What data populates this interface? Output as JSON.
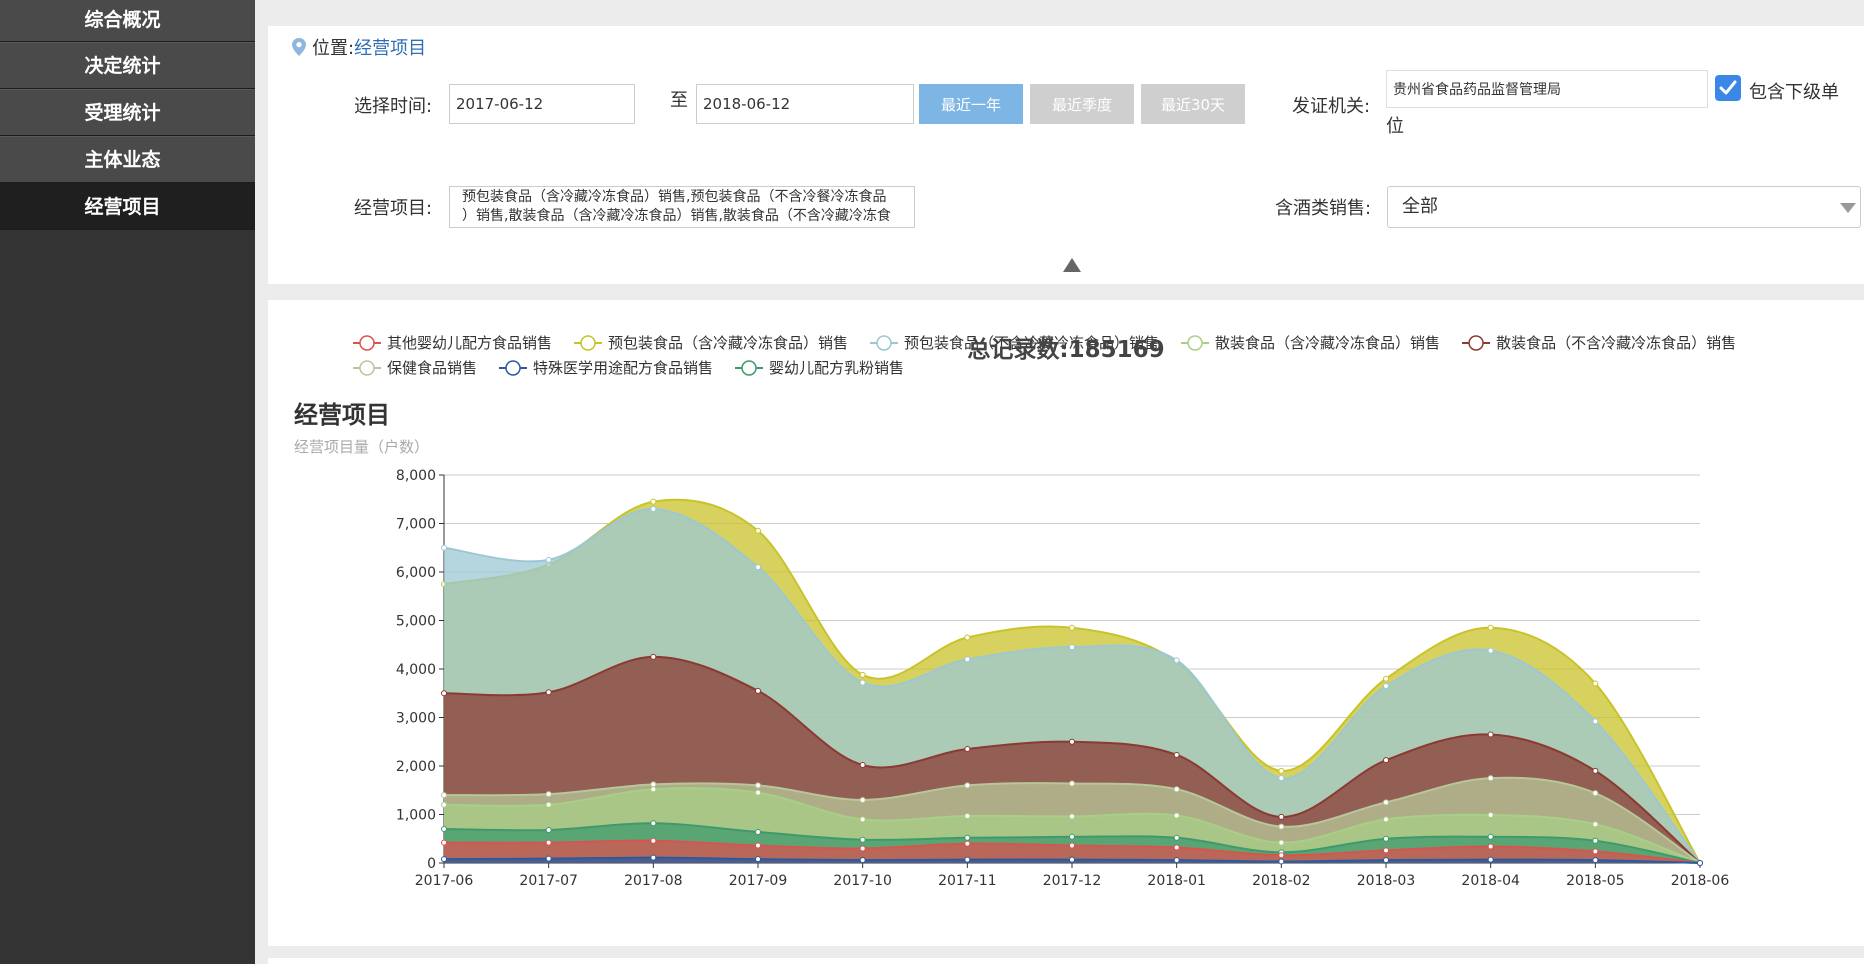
{
  "sidebar": {
    "items": [
      {
        "label": "综合概况",
        "active": false
      },
      {
        "label": "决定统计",
        "active": false
      },
      {
        "label": "受理统计",
        "active": false
      },
      {
        "label": "主体业态",
        "active": false
      },
      {
        "label": "经营项目",
        "active": true
      }
    ]
  },
  "breadcrumb": {
    "prefix": "位置:",
    "current": "经营项目",
    "icon": "location-pin-icon"
  },
  "filters": {
    "time_label": "选择时间:",
    "start_date": "2017-06-12",
    "to_label": "至",
    "end_date": "2018-06-12",
    "btn_last_year": "最近一年",
    "btn_last_quarter": "最近季度",
    "btn_last_30": "最近30天",
    "agency_label": "发证机关:",
    "agency_value": "贵州省食品药品监督管理局",
    "include_sub_label": "包含下级单",
    "include_sub_label_2": "位",
    "include_sub_checked": true,
    "project_label": "经营项目:",
    "project_value_line1": "预包装食品（含冷藏冷冻食品）销售,预包装食品（不含冷餐冷冻食品",
    "project_value_line2": "）销售,散装食品（含冷藏冷冻食品）销售,散装食品（不含冷藏冷冻食",
    "alcohol_label": "含酒类销售:",
    "alcohol_value": "全部"
  },
  "colors": {
    "primary_button": "#7db5e5",
    "muted_button": "#cfcfcf",
    "link": "#2f6fb4",
    "checkbox": "#3b87e6"
  },
  "summary": {
    "total_label": "总记录数:",
    "total_value": "185169"
  },
  "chart_data": {
    "type": "area",
    "title": "经营项目",
    "ylabel": "经营项目量（户数）",
    "ylim": [
      0,
      8000
    ],
    "yticks": [
      "0",
      "1,000",
      "2,000",
      "3,000",
      "4,000",
      "5,000",
      "6,000",
      "7,000",
      "8,000"
    ],
    "grid": true,
    "legend_position": "top",
    "categories": [
      "2017-06",
      "2017-07",
      "2017-08",
      "2017-09",
      "2017-10",
      "2017-11",
      "2017-12",
      "2018-01",
      "2018-02",
      "2018-03",
      "2018-04",
      "2018-05",
      "2018-06"
    ],
    "series": [
      {
        "name": "其他婴幼儿配方食品销售",
        "color": "#d9534f",
        "values": [
          420,
          420,
          460,
          360,
          300,
          400,
          360,
          320,
          160,
          260,
          340,
          240,
          0
        ]
      },
      {
        "name": "预包装食品（含冷藏冷冻食品）销售",
        "color": "#c9c32a",
        "values": [
          5750,
          6150,
          7450,
          6850,
          3880,
          4650,
          4850,
          4150,
          1900,
          3800,
          4850,
          3700,
          0
        ]
      },
      {
        "name": "预包装食品（不含冷藏冷冻食品）销售",
        "color": "#9cc8d4",
        "values": [
          6500,
          6250,
          7300,
          6100,
          3720,
          4200,
          4450,
          4180,
          1750,
          3650,
          4380,
          2920,
          0
        ]
      },
      {
        "name": "散装食品（含冷藏冷冻食品）销售",
        "color": "#a8cf86",
        "values": [
          1200,
          1200,
          1520,
          1450,
          900,
          970,
          960,
          980,
          420,
          900,
          990,
          800,
          0
        ]
      },
      {
        "name": "散装食品（不含冷藏冷冻食品）销售",
        "color": "#8b3a32",
        "values": [
          3500,
          3520,
          4250,
          3550,
          2020,
          2350,
          2500,
          2230,
          950,
          2120,
          2650,
          1900,
          0
        ]
      },
      {
        "name": "保健食品销售",
        "color": "#b8c79a",
        "values": [
          1400,
          1420,
          1620,
          1600,
          1300,
          1600,
          1640,
          1520,
          750,
          1250,
          1750,
          1440,
          0
        ]
      },
      {
        "name": "特殊医学用途配方食品销售",
        "color": "#2a5a9f",
        "values": [
          80,
          90,
          110,
          80,
          60,
          70,
          70,
          60,
          30,
          60,
          70,
          60,
          0
        ]
      },
      {
        "name": "婴幼儿配方乳粉销售",
        "color": "#3e9a6c",
        "values": [
          700,
          680,
          820,
          640,
          480,
          520,
          540,
          520,
          220,
          500,
          540,
          460,
          0
        ]
      }
    ]
  }
}
